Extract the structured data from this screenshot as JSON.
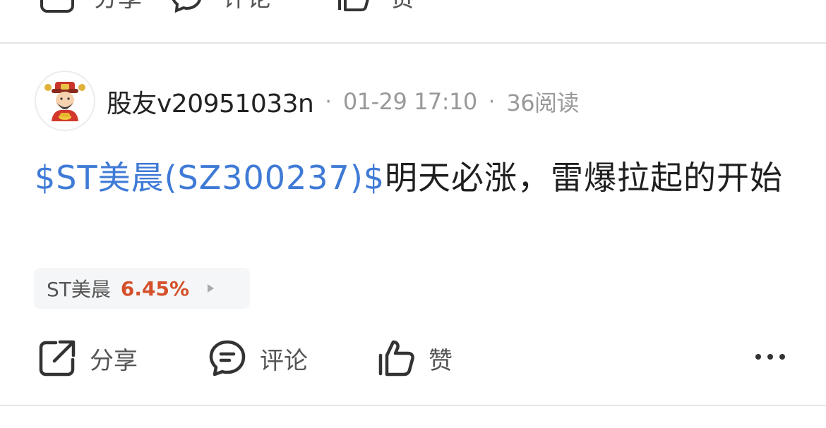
{
  "prev_post_actions": {
    "share_label": "分享",
    "comment_label": "评论",
    "like_label": "赞"
  },
  "post": {
    "username": "股友v20951033n",
    "date": "01-29 17:10",
    "reads": "36阅读",
    "stock_tag": "$ST美晨(SZ300237)$",
    "content": "明天必涨，雷爆拉起的开始",
    "stock_chip": {
      "name": "ST美晨",
      "change": "6.45%"
    },
    "actions": {
      "share_label": "分享",
      "comment_label": "评论",
      "like_label": "赞"
    }
  },
  "icons": {
    "share": "share-icon",
    "comment": "comment-icon",
    "like": "thumbs-up-icon",
    "more": "more-icon",
    "avatar": "fortune-god-avatar"
  },
  "colors": {
    "link": "#3f7ad6",
    "rise": "#d4502a",
    "divider": "#e6e6e6"
  }
}
